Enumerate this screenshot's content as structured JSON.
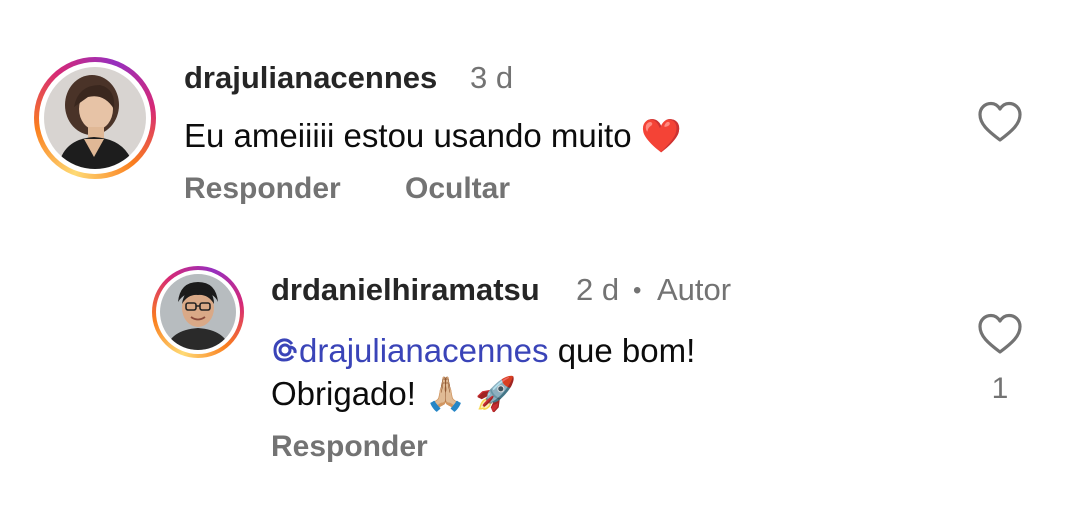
{
  "comments": [
    {
      "username": "drajulianacennes",
      "time": "3 d",
      "text": "Eu ameiiiii estou usando muito",
      "text_emoji": "❤️",
      "actions": {
        "reply": "Responder",
        "hide": "Ocultar"
      },
      "like_icon": "heart-outline"
    }
  ],
  "replies": [
    {
      "username": "drdanielhiramatsu",
      "time": "2 d",
      "separator": "•",
      "badge": "Autor",
      "mention_icon": "threads-at-icon",
      "mention": "drajulianacennes",
      "text_line1_rest": " que bom!",
      "text_line2": "Obrigado!",
      "emoji_1": "🙏🏼",
      "emoji_2": "🚀",
      "actions": {
        "reply": "Responder"
      },
      "like_icon": "heart-outline",
      "like_count": "1"
    }
  ],
  "colors": {
    "username": "#262626",
    "muted": "#737373",
    "mention": "#3a44b8",
    "heart_red": "#e0242b"
  }
}
